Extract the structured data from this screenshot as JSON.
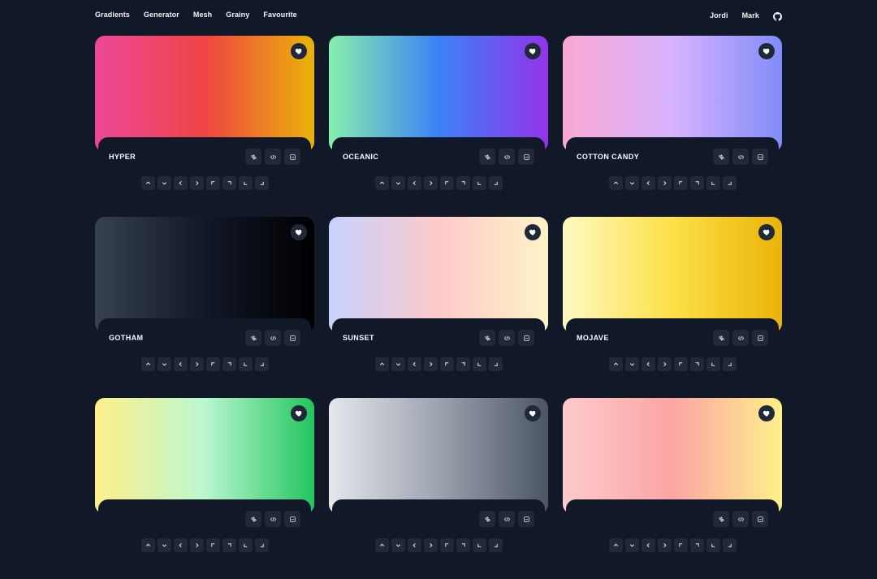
{
  "nav": {
    "left": [
      "Gradients",
      "Generator",
      "Mesh",
      "Grainy",
      "Favourite"
    ],
    "right": [
      "Jordi",
      "Mark"
    ],
    "github_icon": "github-icon"
  },
  "cards": [
    {
      "name": "HYPER",
      "gradient": [
        "#ec4899",
        "#ef4444",
        "#eab308"
      ]
    },
    {
      "name": "OCEANIC",
      "gradient": [
        "#86efac",
        "#3b82f6",
        "#9333ea"
      ]
    },
    {
      "name": "COTTON CANDY",
      "gradient": [
        "#f9a8d4",
        "#d8b4fe",
        "#818cf8"
      ]
    },
    {
      "name": "GOTHAM",
      "gradient": [
        "#374151",
        "#111827",
        "#000000"
      ]
    },
    {
      "name": "SUNSET",
      "gradient": [
        "#c7d2fe",
        "#fecaca",
        "#fef3c7"
      ]
    },
    {
      "name": "MOJAVE",
      "gradient": [
        "#fef9c3",
        "#fde047",
        "#eab308"
      ]
    },
    {
      "name": "",
      "gradient": [
        "#fef08a",
        "#bbf7d0",
        "#22c55e"
      ]
    },
    {
      "name": "",
      "gradient": [
        "#e5e7eb",
        "#9ca3af",
        "#4b5563"
      ]
    },
    {
      "name": "",
      "gradient": [
        "#fecaca",
        "#fca5a5",
        "#fef08a"
      ]
    }
  ],
  "card_actions": [
    "shuffle-icon",
    "code-icon",
    "save-icon"
  ],
  "direction_icons": [
    "arrow-up-icon",
    "arrow-down-icon",
    "arrow-left-icon",
    "arrow-right-icon",
    "corner-top-left-icon",
    "corner-top-right-icon",
    "corner-bottom-left-icon",
    "corner-bottom-right-icon"
  ],
  "favourite_icon": "heart-icon"
}
